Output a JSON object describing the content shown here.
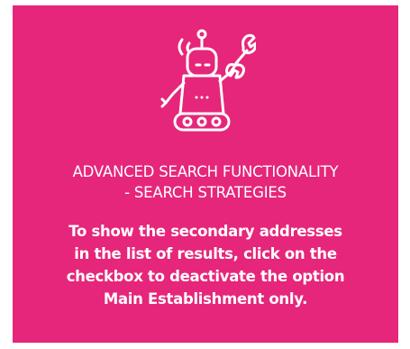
{
  "card": {
    "background": "#e6267a",
    "icon": "robot-with-wrench-icon"
  },
  "heading": {
    "line1": "ADVANCED SEARCH FUNCTIONALITY",
    "line2": "- SEARCH STRATEGIES"
  },
  "body": {
    "line1": "To show the secondary addresses",
    "line2": "in the list of results, click on the",
    "line3": "checkbox to deactivate the option",
    "line4": "Main Establishment only."
  }
}
